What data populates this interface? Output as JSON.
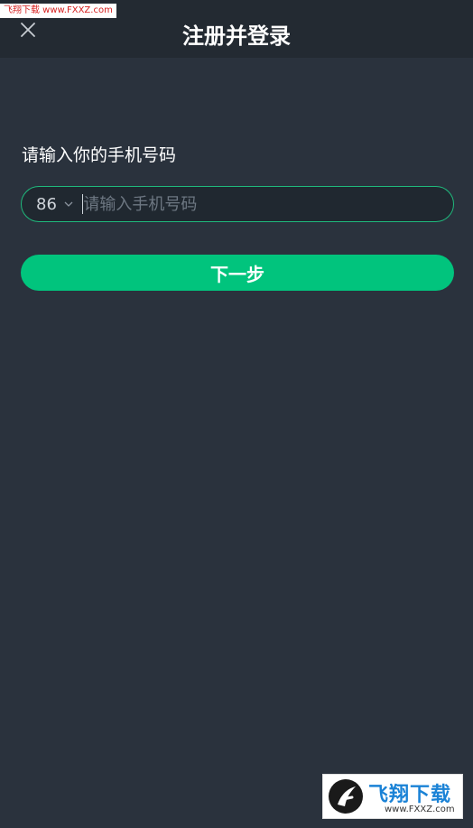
{
  "watermark": {
    "top_text": "飞翔下载 www.FXXZ.com"
  },
  "header": {
    "title": "注册并登录",
    "close_icon": "close-icon"
  },
  "form": {
    "prompt": "请输入你的手机号码",
    "country_code": "86",
    "phone_placeholder": "请输入手机号码",
    "phone_value": "",
    "next_label": "下一步"
  },
  "logo": {
    "brand": "飞翔下载",
    "url": "www.FXXZ.com"
  },
  "colors": {
    "background": "#2a323d",
    "header": "#232a32",
    "accent": "#01c47d",
    "field_border": "#1fb97c"
  }
}
